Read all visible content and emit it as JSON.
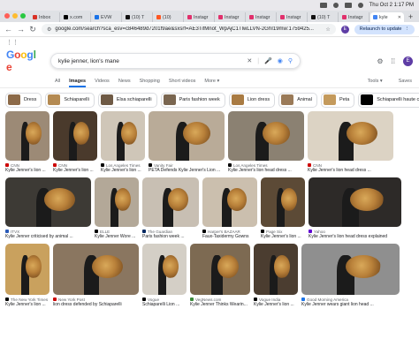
{
  "menubar": {
    "datetime": "Thu Oct 2  1:17 PM"
  },
  "tabs": [
    {
      "label": "Inbox",
      "color": "#d93025"
    },
    {
      "label": "x.com",
      "color": "#000000"
    },
    {
      "label": "EVW",
      "color": "#1a73e8"
    },
    {
      "label": "(10) T",
      "color": "#111111"
    },
    {
      "label": "(10)",
      "color": "#ff5722"
    },
    {
      "label": "Instagr",
      "color": "#e1306c"
    },
    {
      "label": "Instagr",
      "color": "#e1306c"
    },
    {
      "label": "Instagr",
      "color": "#e1306c"
    },
    {
      "label": "Instagr",
      "color": "#e1306c"
    },
    {
      "label": "(10) T",
      "color": "#111111"
    },
    {
      "label": "Instagr",
      "color": "#e1306c"
    },
    {
      "label": "kyle",
      "color": "#4285f4",
      "active": true
    }
  ],
  "toolbar": {
    "url": "google.com/search?sca_esv=c846489d7201f9ae&sxsrf=AE3TifMnot_WpAjC1TlwLLVN-2GhI19mw:1759425...",
    "relaunch": "Relaunch to update",
    "profile_initial": "E"
  },
  "search": {
    "query": "kylie jenner, lion's mane",
    "avatar_initial": "E"
  },
  "search_tabs": [
    "All",
    "Images",
    "Videos",
    "News",
    "Shopping",
    "Short videos",
    "More ▾"
  ],
  "search_tabs_active": "Images",
  "tools_label": "Tools ▾",
  "saves_label": "Saves",
  "chips": [
    {
      "label": "Dress",
      "color": "#8c6a48"
    },
    {
      "label": "Schiaparelli",
      "color": "#b48a52"
    },
    {
      "label": "Elsa schiaparelli",
      "color": "#6f5a45"
    },
    {
      "label": "Paris fashion week",
      "color": "#7a6650"
    },
    {
      "label": "Lion dress",
      "color": "#a97b43"
    },
    {
      "label": "Animal",
      "color": "#9a7a58"
    },
    {
      "label": "Peta",
      "color": "#c49a5c"
    },
    {
      "label": "Schiaparelli haute couture",
      "color": "#000000"
    }
  ],
  "rows": [
    [
      {
        "source": "CNN",
        "title": "Kylie Jenner's lion ...",
        "bg": "#9c8a76",
        "src_color": "#cc0000"
      },
      {
        "source": "CNN",
        "title": "Kylie Jenner's lion ...",
        "bg": "#4a3a2c",
        "src_color": "#cc0000"
      },
      {
        "source": "Los Angeles Times",
        "title": "Kylie Jenner's lion ...",
        "bg": "#cfc6b8",
        "src_color": "#000000"
      },
      {
        "source": "Vanity Fair",
        "title": "PETA Defends Kylie Jenner's Lion ...",
        "bg": "#b9ab98",
        "src_color": "#000000"
      },
      {
        "source": "Los Angeles Times",
        "title": "Kylie Jenner's lion head dress ...",
        "bg": "#8b8172",
        "src_color": "#000000"
      },
      {
        "source": "CNN",
        "title": "Kylie Jenner's lion head dress ...",
        "bg": "#dcd3c4",
        "src_color": "#cc0000"
      }
    ],
    [
      {
        "source": "ITVX",
        "title": "Kylie Jenner criticised by animal ...",
        "bg": "#3d3a35",
        "src_color": "#2b5bb8"
      },
      {
        "source": "ELLE",
        "title": "Kylie Jenner Wore ...",
        "bg": "#b3a898",
        "src_color": "#000000"
      },
      {
        "source": "The Guardian",
        "title": "Paris fashion week ...",
        "bg": "#c8bfb3",
        "src_color": "#052962"
      },
      {
        "source": "Harper's BAZAAR",
        "title": "Faux-Taxidermy Gowns",
        "bg": "#cbbfae",
        "src_color": "#000000"
      },
      {
        "source": "Page Six",
        "title": "Kylie Jenner's lion ...",
        "bg": "#5c4a36",
        "src_color": "#000000"
      },
      {
        "source": "Yahoo",
        "title": "Kylie Jenner's lion head dress explained",
        "bg": "#2d2a28",
        "src_color": "#6001d2"
      }
    ],
    [
      {
        "source": "The New York Times",
        "title": "Kylie Jenner's lion ...",
        "bg": "#c9a15e",
        "src_color": "#000000"
      },
      {
        "source": "New York Post",
        "title": "lion dress defended by Schiaparelli",
        "bg": "#8a7660",
        "src_color": "#cc0000"
      },
      {
        "source": "Vogue",
        "title": "Schiaparelli Lion ...",
        "bg": "#d4cfc6",
        "src_color": "#000000"
      },
      {
        "source": "VegNews.com",
        "title": "Kylie Jenner Thinks Wearin...",
        "bg": "#7d6a52",
        "src_color": "#3a8a3a"
      },
      {
        "source": "Vogue India",
        "title": "Kylie Jenner's lion ...",
        "bg": "#4b3d30",
        "src_color": "#000000"
      },
      {
        "source": "Good Morning America",
        "title": "Kylie Jenner wears giant lion head ...",
        "bg": "#8f8f8f",
        "src_color": "#1a73e8"
      }
    ]
  ]
}
